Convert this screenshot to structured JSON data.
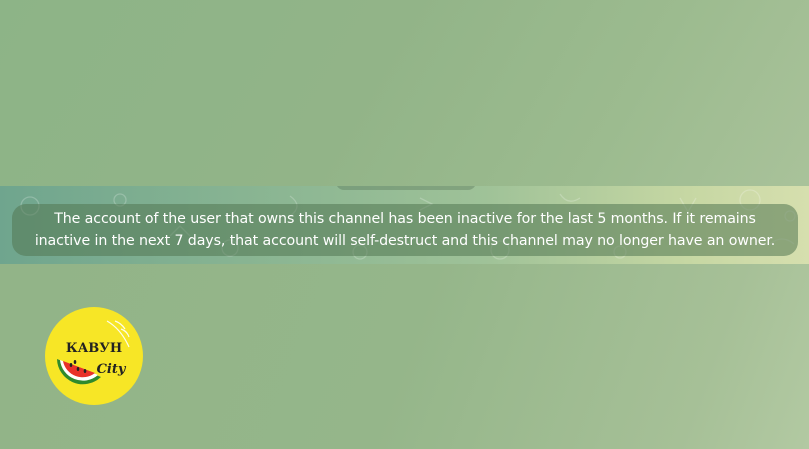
{
  "notice": {
    "line1": "The account of the user that owns this channel has been inactive for the last 5 months. If it remains",
    "line2": "inactive in the next 7 days, that account will self-destruct and this channel may no longer have an owner."
  },
  "channel_avatar": {
    "logo_text_top": "КАВУН",
    "logo_text_bottom": "City",
    "icon": "watermelon-icon",
    "background_color": "#f7e626"
  },
  "colors": {
    "wallpaper": "#93b58a",
    "notice_bg": "#527652",
    "watermelon_red": "#e8322a",
    "watermelon_green": "#2f8a2c"
  }
}
